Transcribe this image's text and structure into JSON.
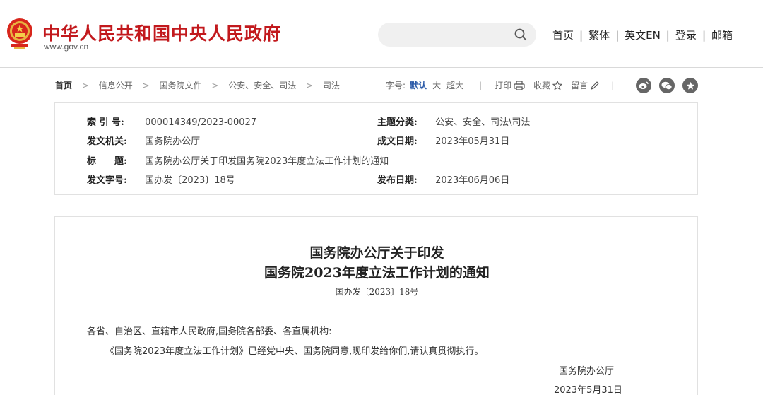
{
  "header": {
    "site_title": "中华人民共和国中央人民政府",
    "site_domain": "www.gov.cn",
    "search_placeholder": "",
    "nav": [
      "首页",
      "繁体",
      "英文EN",
      "登录",
      "邮箱"
    ],
    "nav_separator": "|",
    "brand_color": "#c2191d"
  },
  "breadcrumb": {
    "items": [
      "首页",
      "信息公开",
      "国务院文件",
      "公安、安全、司法",
      "司法"
    ],
    "separator": ">"
  },
  "tools": {
    "font_size_label": "字号:",
    "font_sizes": [
      "默认",
      "大",
      "超大"
    ],
    "active_font_size": "默认",
    "print_label": "打印",
    "favorite_label": "收藏",
    "comment_label": "留言",
    "separator": "|",
    "share_icons": [
      "weibo-icon",
      "wechat-icon",
      "star-icon"
    ]
  },
  "info": {
    "index_label": "索 引 号:",
    "index_value": "000014349/2023-00027",
    "category_label": "主题分类:",
    "category_value": "公安、安全、司法\\司法",
    "issuer_label": "发文机关:",
    "issuer_value": "国务院办公厅",
    "written_label": "成文日期:",
    "written_value": "2023年05月31日",
    "title_label": "标　　题:",
    "title_value": "国务院办公厅关于印发国务院2023年度立法工作计划的通知",
    "doc_no_label": "发文字号:",
    "doc_no_value": "国办发〔2023〕18号",
    "publish_label": "发布日期:",
    "publish_value": "2023年06月06日"
  },
  "document": {
    "title_line1": "国务院办公厅关于印发",
    "title_line2": "国务院2023年度立法工作计划的通知",
    "doc_number": "国办发〔2023〕18号",
    "salutation": "各省、自治区、直辖市人民政府,国务院各部委、各直属机构:",
    "body": "《国务院2023年度立法工作计划》已经党中央、国务院同意,现印发给你们,请认真贯彻执行。",
    "signer": "国务院办公厅",
    "date": "2023年5月31日"
  }
}
